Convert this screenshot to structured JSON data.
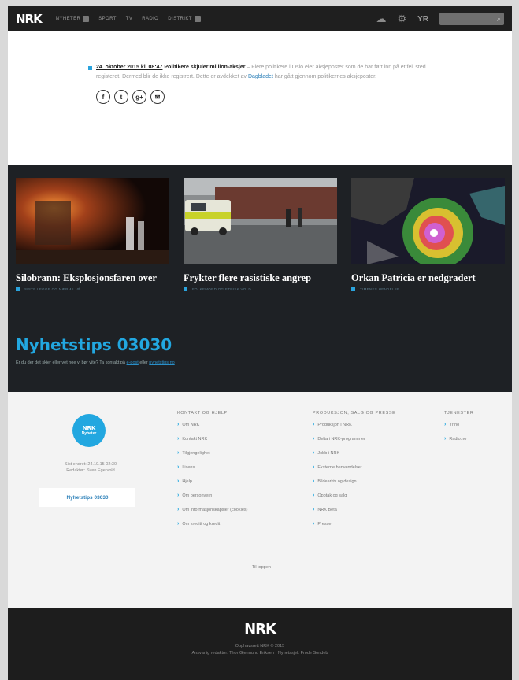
{
  "nav": {
    "logo": "NRK",
    "items": [
      "NYHETER",
      "SPORT",
      "TV",
      "RADIO",
      "DISTRIKT"
    ],
    "yr": "YR"
  },
  "article": {
    "date": "24. oktober 2015 kl. 08:47",
    "title": "Politikere skjuler million-aksjer",
    "summary": "– Flere politikere i Oslo eier aksjeposter som de har ført inn på et feil sted i registeret. Dermed blir de ikke registrert. Dette er avdekket av",
    "link": "Dagbladet",
    "summary_end": "har gått gjennom politikernes aksjeposter.",
    "shares": [
      "f",
      "t",
      "g+",
      "✉"
    ]
  },
  "news": [
    {
      "title": "Silobrann: Eksplosjonsfaren over",
      "meta": "SISTE LEGGE OG NÆRMILJØ"
    },
    {
      "title": "Frykter flere rasistiske angrep",
      "meta": "FOLKEMORD OG ETNISK VOLD"
    },
    {
      "title": "Orkan Patricia er nedgradert",
      "meta": "TIMENES HENDELSE"
    }
  ],
  "tips": {
    "title": "Nyhetstips 03030",
    "text": "Er du der det skjer eller vet noe vi bør vite? Ta kontakt på",
    "link1": "e-post",
    "mid": "eller",
    "link2": "nyhetstips.no"
  },
  "footer": {
    "badge_top": "NRK",
    "badge_bottom": "Nyheter",
    "updated": "Sist endret: 24.10.15 02:30",
    "editor": "Redaktør: Sven Egervold",
    "tips_button": "Nyhetstips 03030",
    "columns": [
      {
        "heading": "KONTAKT OG HJELP",
        "links": [
          "Om NRK",
          "Kontakt NRK",
          "Tilgjengelighet",
          "Lisens",
          "Hjelp",
          "Om personvern",
          "Om informasjonskapsler (cookies)",
          "Om kreditt og kredit"
        ]
      },
      {
        "heading": "PRODUKSJON, SALG OG PRESSE",
        "links": [
          "Produksjon i NRK",
          "Delta i NRK-programmer",
          "Jobb i NRK",
          "Eksterne henvendelser",
          "Bildearkiv og design",
          "Opptak og salg",
          "NRK Beta",
          "Presse"
        ]
      },
      {
        "heading": "TJENESTER",
        "links": [
          "Yr.no",
          "Radio.no"
        ]
      }
    ],
    "to_top": "Til toppen"
  },
  "bottom": {
    "logo": "NRK",
    "copyright": "Opphavsrett NRK © 2015",
    "line": "Ansvarlig redaktør: Thor Gjermund Eriksen · Nyhetssjef: Frode Sondeb"
  },
  "colors": {
    "accent": "#22a7e0",
    "nav_bg": "#1f1f1f",
    "dark_bg": "#1e2125"
  }
}
